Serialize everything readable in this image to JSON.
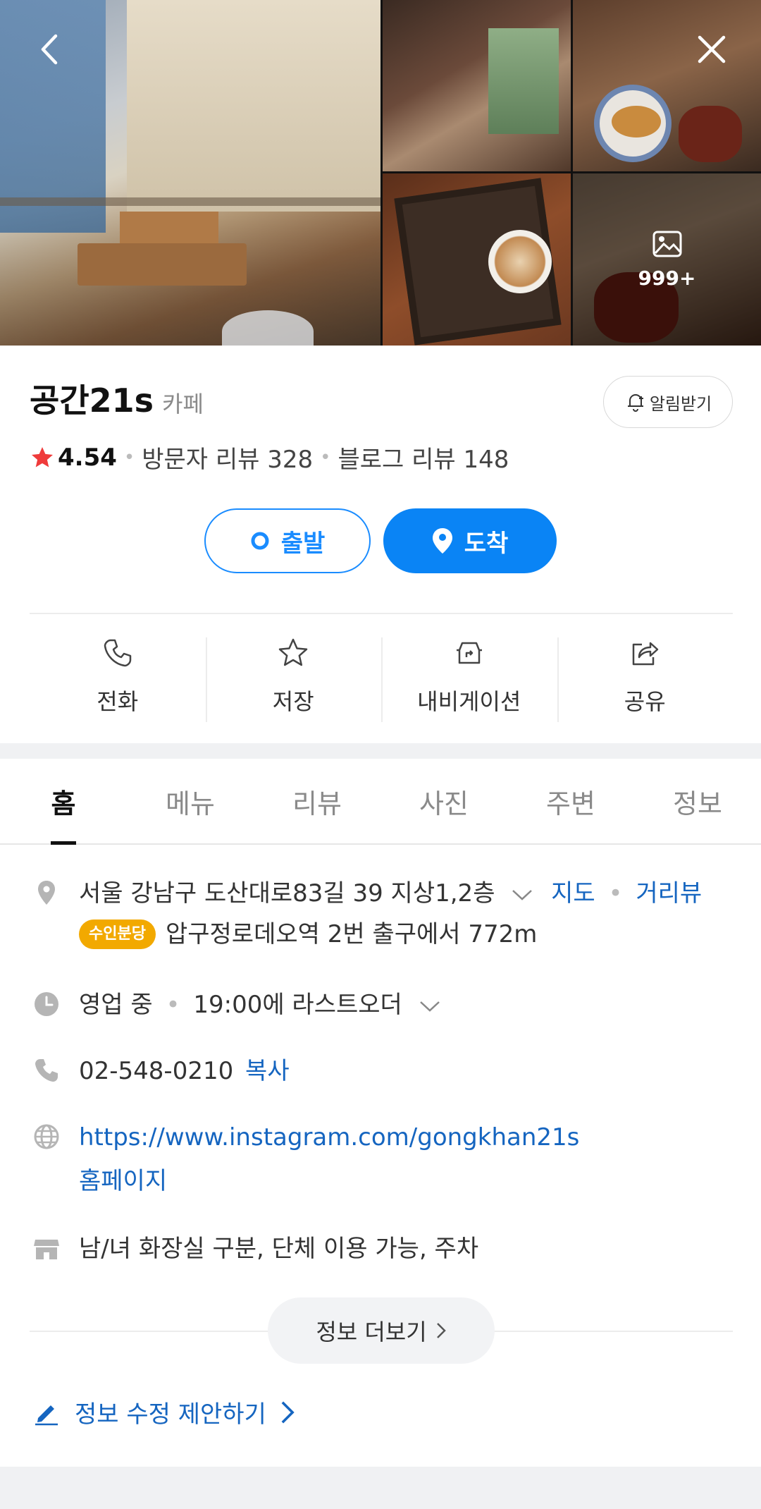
{
  "photos": {
    "more_count": "999+"
  },
  "place": {
    "name": "공간21s",
    "category": "카페",
    "alarm_label": "알림받기",
    "rating": "4.54",
    "visitor_reviews": "방문자 리뷰 328",
    "blog_reviews": "블로그 리뷰 148"
  },
  "route": {
    "start_label": "출발",
    "arrive_label": "도착"
  },
  "actions": [
    {
      "label": "전화",
      "icon": "phone-icon"
    },
    {
      "label": "저장",
      "icon": "star-outline-icon"
    },
    {
      "label": "내비게이션",
      "icon": "navigation-car-icon"
    },
    {
      "label": "공유",
      "icon": "share-icon"
    }
  ],
  "tabs": [
    "홈",
    "메뉴",
    "리뷰",
    "사진",
    "주변",
    "정보"
  ],
  "active_tab": "홈",
  "info": {
    "address": "서울 강남구 도산대로83길 39 지상1,2층",
    "map_link": "지도",
    "street_view_link": "거리뷰",
    "badge": "수인분당",
    "station_distance": "압구정로데오역 2번 출구에서 772m",
    "hours_status": "영업 중",
    "hours_detail": "19:00에 라스트오더",
    "phone": "02-548-0210",
    "copy_label": "복사",
    "website_url": "https://www.instagram.com/gongkhan21s",
    "homepage_label": "홈페이지",
    "amenities": "남/녀 화장실 구분, 단체 이용 가능, 주차"
  },
  "more_info_label": "정보 더보기",
  "suggest_edit_label": "정보 수정 제안하기",
  "colors": {
    "primary_blue": "#0a84f5",
    "link_blue": "#1565c0",
    "rating_star": "#ef3b3b",
    "badge_yellow": "#f2a900"
  }
}
